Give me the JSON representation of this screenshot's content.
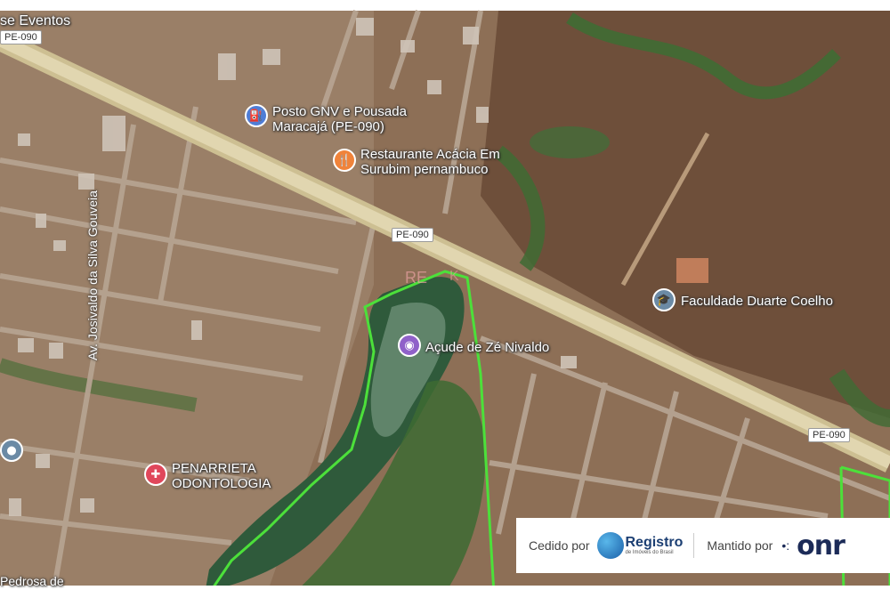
{
  "map": {
    "road_shields": [
      "PE-090",
      "PE-090",
      "PE-090"
    ],
    "labels": {
      "eventos": "se Eventos",
      "posto": "Posto GNV e Pousada\nMaracajá (PE-090)",
      "restaurante": "Restaurante Acácia Em\nSurubim pernambuco",
      "faculdade": "Faculdade Duarte Coelho",
      "acude": "Açude de Zé Nivaldo",
      "penarrieta": "PENARRIETA\nODONTOLOGIA",
      "avenida": "Av. Josivaldo da Silva Gouveia",
      "pedrosa": "Pedrosa de"
    },
    "icons": {
      "posto": "gas-station-icon",
      "restaurante": "fork-knife-icon",
      "faculdade": "graduation-cap-icon",
      "acude": "camera-icon",
      "penarrieta": "medical-cross-icon",
      "unknown_pin": "location-pin-icon"
    },
    "colors": {
      "highlight_border": "#4ce03a",
      "water": "#1f4a2e",
      "terrain": "#8b6a4f",
      "highway": "#d9cfa6",
      "poi_orange": "#f0833a",
      "poi_blue": "#4f7dd6",
      "poi_purple": "#9061c9",
      "poi_red": "#e0475b",
      "poi_gray": "#6b8aa5"
    }
  },
  "footer": {
    "ceded_label": "Cedido por",
    "registro_name": "Registro",
    "registro_sub": "de Imóveis do Brasil",
    "maintained_label": "Mantido por",
    "onr_name": "onr"
  }
}
